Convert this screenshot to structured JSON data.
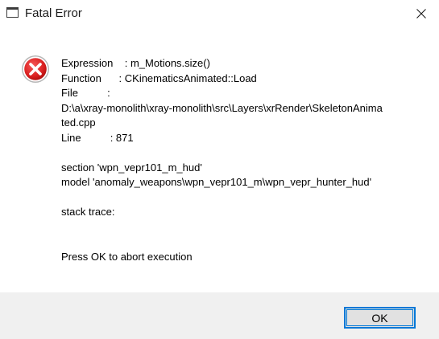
{
  "window": {
    "title": "Fatal Error",
    "icon": "window-app-icon",
    "close_icon": "close-icon"
  },
  "dialog": {
    "icon": "error-icon",
    "icon_color": "#e81123",
    "lines": {
      "expression": "Expression    : m_Motions.size()",
      "function": "Function      : CKinematicsAnimated::Load",
      "file": "File          :",
      "path_line1": "D:\\a\\xray-monolith\\xray-monolith\\src\\Layers\\xrRender\\SkeletonAnima",
      "path_line2": "ted.cpp",
      "line": "Line          : 871",
      "section": "section 'wpn_vepr101_m_hud'",
      "model": "model 'anomaly_weapons\\wpn_vepr101_m\\wpn_vepr_hunter_hud'",
      "stack_trace": "stack trace:",
      "abort": "Press OK to abort execution"
    }
  },
  "buttons": {
    "ok_label": "OK"
  },
  "colors": {
    "footer_bg": "#f0f0f0",
    "accent": "#0078d7",
    "button_bg": "#e1e1e1"
  }
}
